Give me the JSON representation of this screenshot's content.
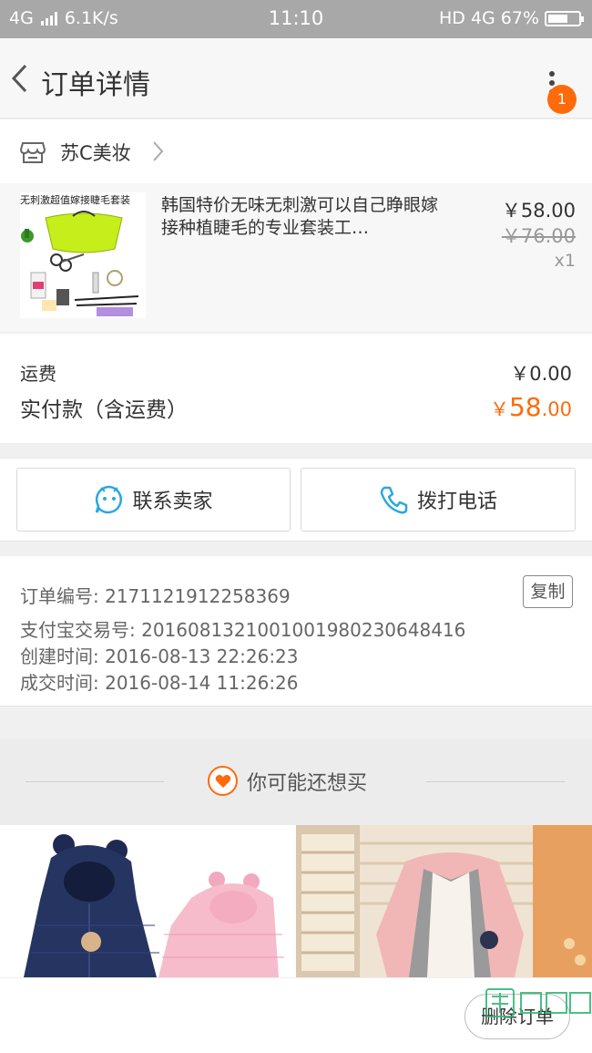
{
  "status_bar": {
    "network": "4G",
    "speed": "6.1K/s",
    "time": "11:10",
    "hd_network": "HD 4G",
    "battery": "67%",
    "battery_level": 0.67
  },
  "header": {
    "title": "订单详情",
    "badge_count": "1"
  },
  "shop": {
    "name": "苏C美妆"
  },
  "product": {
    "image_banner": "无刺激超值嫁接睫毛套装",
    "title": "韩国特价无味无刺激可以自己睁眼嫁接种植睫毛的专业套装工…",
    "price": "￥58.00",
    "original_price": "￥76.00",
    "quantity": "x1"
  },
  "costs": {
    "shipping_label": "运费",
    "shipping_value": "￥0.00",
    "paid_label": "实付款（含运费）",
    "paid_symbol": "￥",
    "paid_integer": "58",
    "paid_decimal": ".00"
  },
  "actions": {
    "contact_seller": "联系卖家",
    "call_phone": "拨打电话"
  },
  "order_info": {
    "order_no": "订单编号: 2171121912258369",
    "alipay_no": "支付宝交易号: 2016081321001001980230648416",
    "created": "创建时间: 2016-08-13 22:26:23",
    "completed": "成交时间: 2016-08-14 11:26:26",
    "copy_label": "复制"
  },
  "recommend": {
    "title": "你可能还想买"
  },
  "footer": {
    "delete_label": "删除订单",
    "watermark_text": "JiChengXin.com"
  },
  "colors": {
    "accent": "#ff6a0a",
    "status_bar": "#a8a8a8",
    "icon_blue": "#2aa8e0"
  }
}
